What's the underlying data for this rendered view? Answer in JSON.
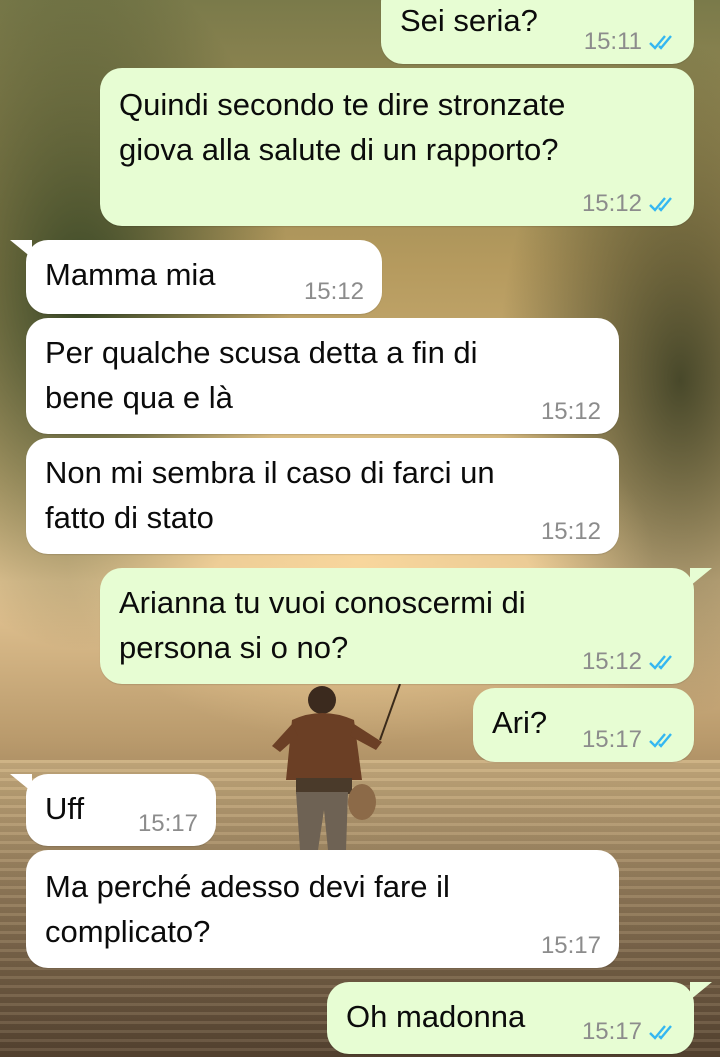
{
  "chat": {
    "messages": [
      {
        "dir": "out",
        "lines": [
          "Sei seria?"
        ],
        "time": "15:11",
        "read": true
      },
      {
        "dir": "out",
        "lines": [
          "Quindi secondo te dire stronzate",
          "giova alla salute di un rapporto?"
        ],
        "time": "15:12",
        "read": true
      },
      {
        "dir": "in",
        "lines": [
          "Mamma mia"
        ],
        "time": "15:12"
      },
      {
        "dir": "in",
        "lines": [
          "Per qualche scusa detta a fin di",
          "bene qua e là"
        ],
        "time": "15:12"
      },
      {
        "dir": "in",
        "lines": [
          "Non mi sembra il caso di farci un",
          "fatto di stato"
        ],
        "time": "15:12"
      },
      {
        "dir": "out",
        "lines": [
          "Arianna tu vuoi conoscermi di",
          "persona si o no?"
        ],
        "time": "15:12",
        "read": true
      },
      {
        "dir": "out",
        "lines": [
          "Ari?"
        ],
        "time": "15:17",
        "read": true
      },
      {
        "dir": "in",
        "lines": [
          "Uff"
        ],
        "time": "15:17"
      },
      {
        "dir": "in",
        "lines": [
          "Ma perché adesso devi fare il",
          "complicato?"
        ],
        "time": "15:17"
      },
      {
        "dir": "out",
        "lines": [
          "Oh madonna"
        ],
        "time": "15:17",
        "read": true
      }
    ]
  },
  "colors": {
    "outgoing_bubble": "#e7fdd3",
    "incoming_bubble": "#ffffff",
    "read_tick": "#34b7f1",
    "timestamp": "#8c8c8c"
  },
  "icons": {
    "read_receipt": "double-check-icon"
  }
}
